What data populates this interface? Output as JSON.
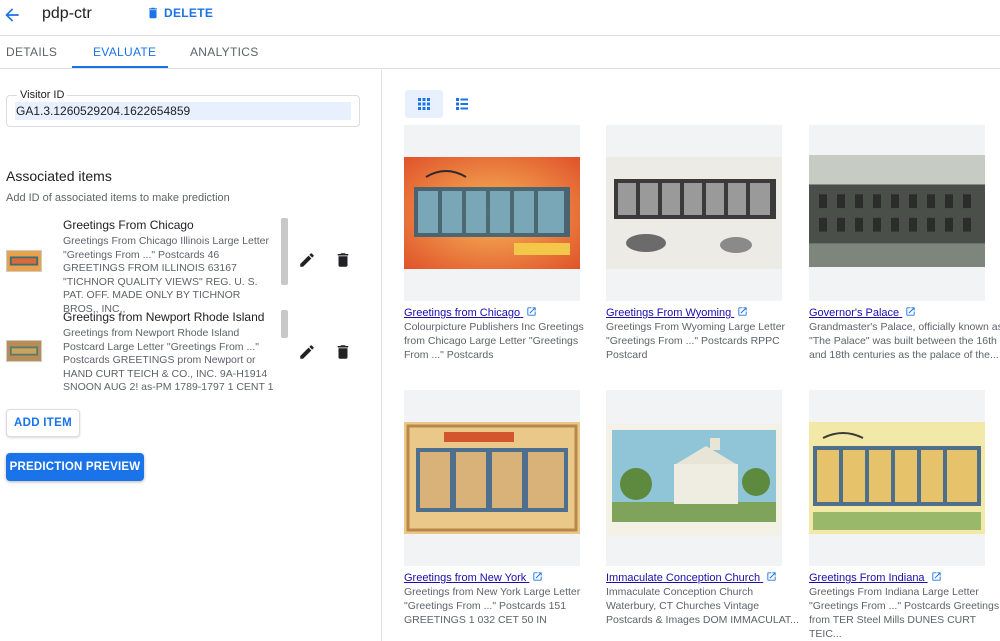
{
  "header": {
    "title": "pdp-ctr",
    "delete_label": "DELETE"
  },
  "tabs": [
    {
      "label": "DETAILS"
    },
    {
      "label": "EVALUATE"
    },
    {
      "label": "ANALYTICS"
    }
  ],
  "visitor": {
    "label": "Visitor ID",
    "value": "GA1.3.1260529204.1622654859"
  },
  "associated": {
    "title": "Associated items",
    "subtitle": "Add ID of associated items to make prediction",
    "items": [
      {
        "title": "Greetings From Chicago",
        "desc": "Greetings From Chicago Illinois Large Letter \"Greetings From ...\" Postcards 46 GREETINGS FROM ILLINOIS 63167 \"TICHNOR QUALITY VIEWS\" REG. U. S. PAT. OFF. MADE ONLY BY TICHNOR BROS., INC.,"
      },
      {
        "title": "Greetings from Newport Rhode Island",
        "desc": "Greetings from Newport Rhode Island Postcard Large Letter \"Greetings From ...\" Postcards GREETINGS prom Newport or HAND CURT TEICH & CO., INC. 9A-H1914 SNOON AUG 2! as-PM 1789-1797 1 CENT 1"
      }
    ],
    "add_label": "ADD ITEM",
    "predict_label": "PREDICTION PREVIEW"
  },
  "results": [
    {
      "title": "Greetings from Chicago",
      "desc": "Colourpicture Publishers Inc Greetings from Chicago Large Letter \"Greetings From ...\" Postcards"
    },
    {
      "title": "Greetings From Wyoming",
      "desc": "Greetings From Wyoming Large Letter \"Greetings From ...\" Postcards RPPC Postcard"
    },
    {
      "title": "Governor's Palace",
      "desc": "Grandmaster's Palace, officially known as \"The Palace\" was built between the 16th and 18th centuries as the palace of the..."
    },
    {
      "title": "Greetings from New York",
      "desc": "Greetings from New York Large Letter \"Greetings From ...\" Postcards 151 GREETINGS 1 032 CET 50 IN"
    },
    {
      "title": "Immaculate Conception Church",
      "desc": "Immaculate Conception Church Waterbury, CT Churches Vintage Postcards & Images DOM IMMACULAT..."
    },
    {
      "title": "Greetings From Indiana",
      "desc": "Greetings From Indiana Large Letter \"Greetings From ...\" Postcards Greetings from TER Steel Mills DUNES CURT TEIC..."
    }
  ],
  "colors": {
    "accent": "#1a73e8",
    "link": "#1a0dab"
  }
}
